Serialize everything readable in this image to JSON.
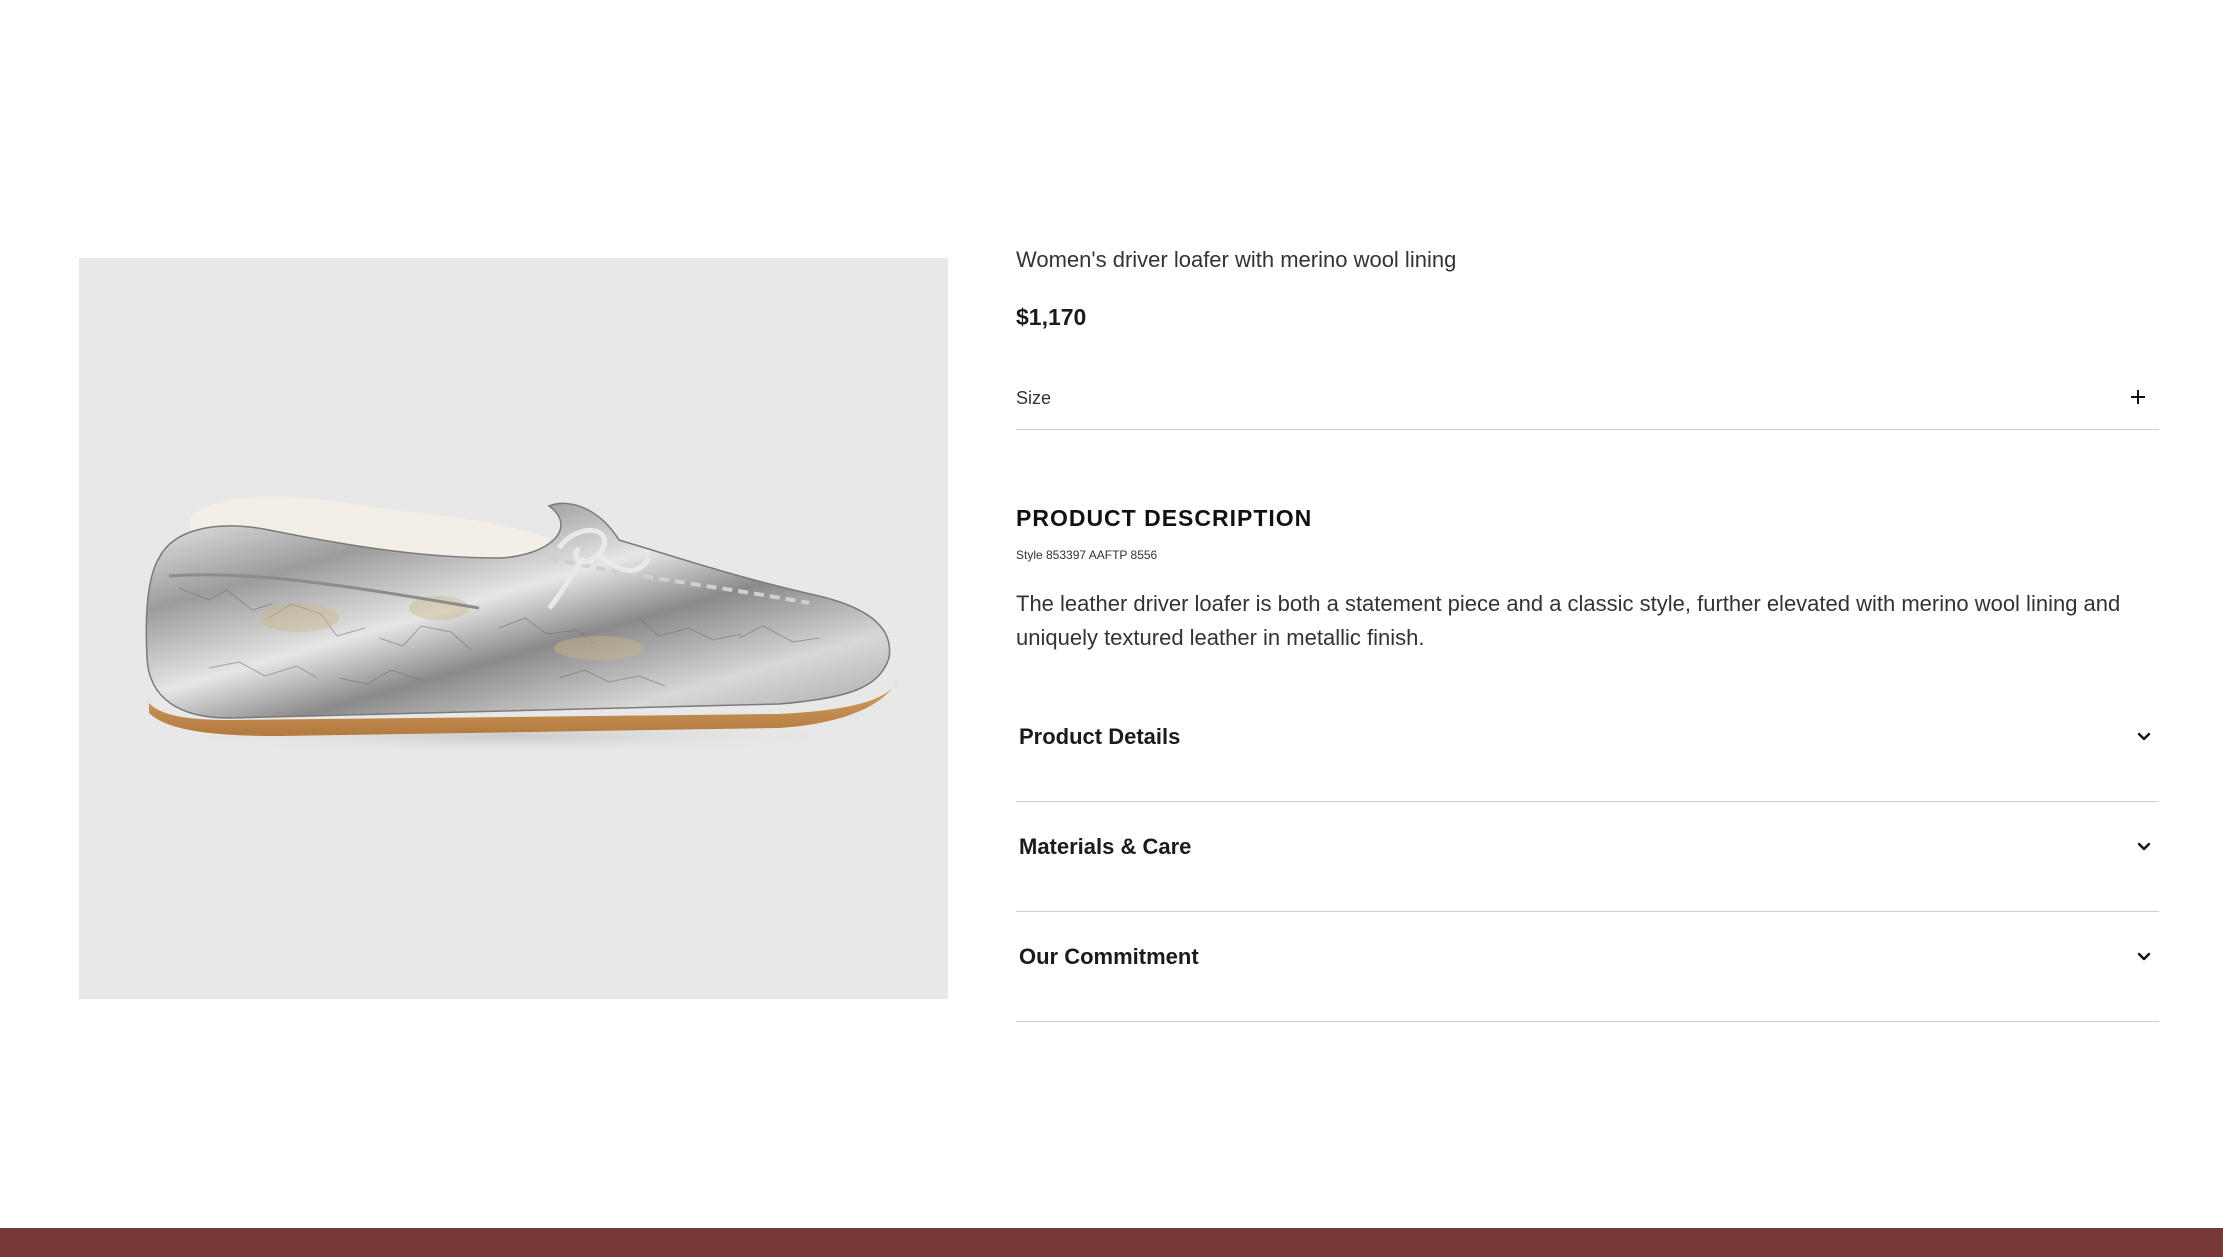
{
  "product": {
    "title": "Women's driver loafer with merino wool lining",
    "price": "$1,170",
    "image_alt": "Silver metallic leather driver loafer with shearling lining",
    "size_label": "Size"
  },
  "description": {
    "heading": "PRODUCT DESCRIPTION",
    "style_number": "Style 853397 AAFTP 8556",
    "body": "The leather driver loafer is both a statement piece and a classic style, further elevated with merino wool lining and uniquely textured leather in metallic finish."
  },
  "accordions": [
    {
      "label": "Product Details"
    },
    {
      "label": "Materials & Care"
    },
    {
      "label": "Our Commitment"
    }
  ],
  "colors": {
    "image_background": "#e8e8e8",
    "footer": "#793838",
    "divider": "#cfcfcf"
  }
}
